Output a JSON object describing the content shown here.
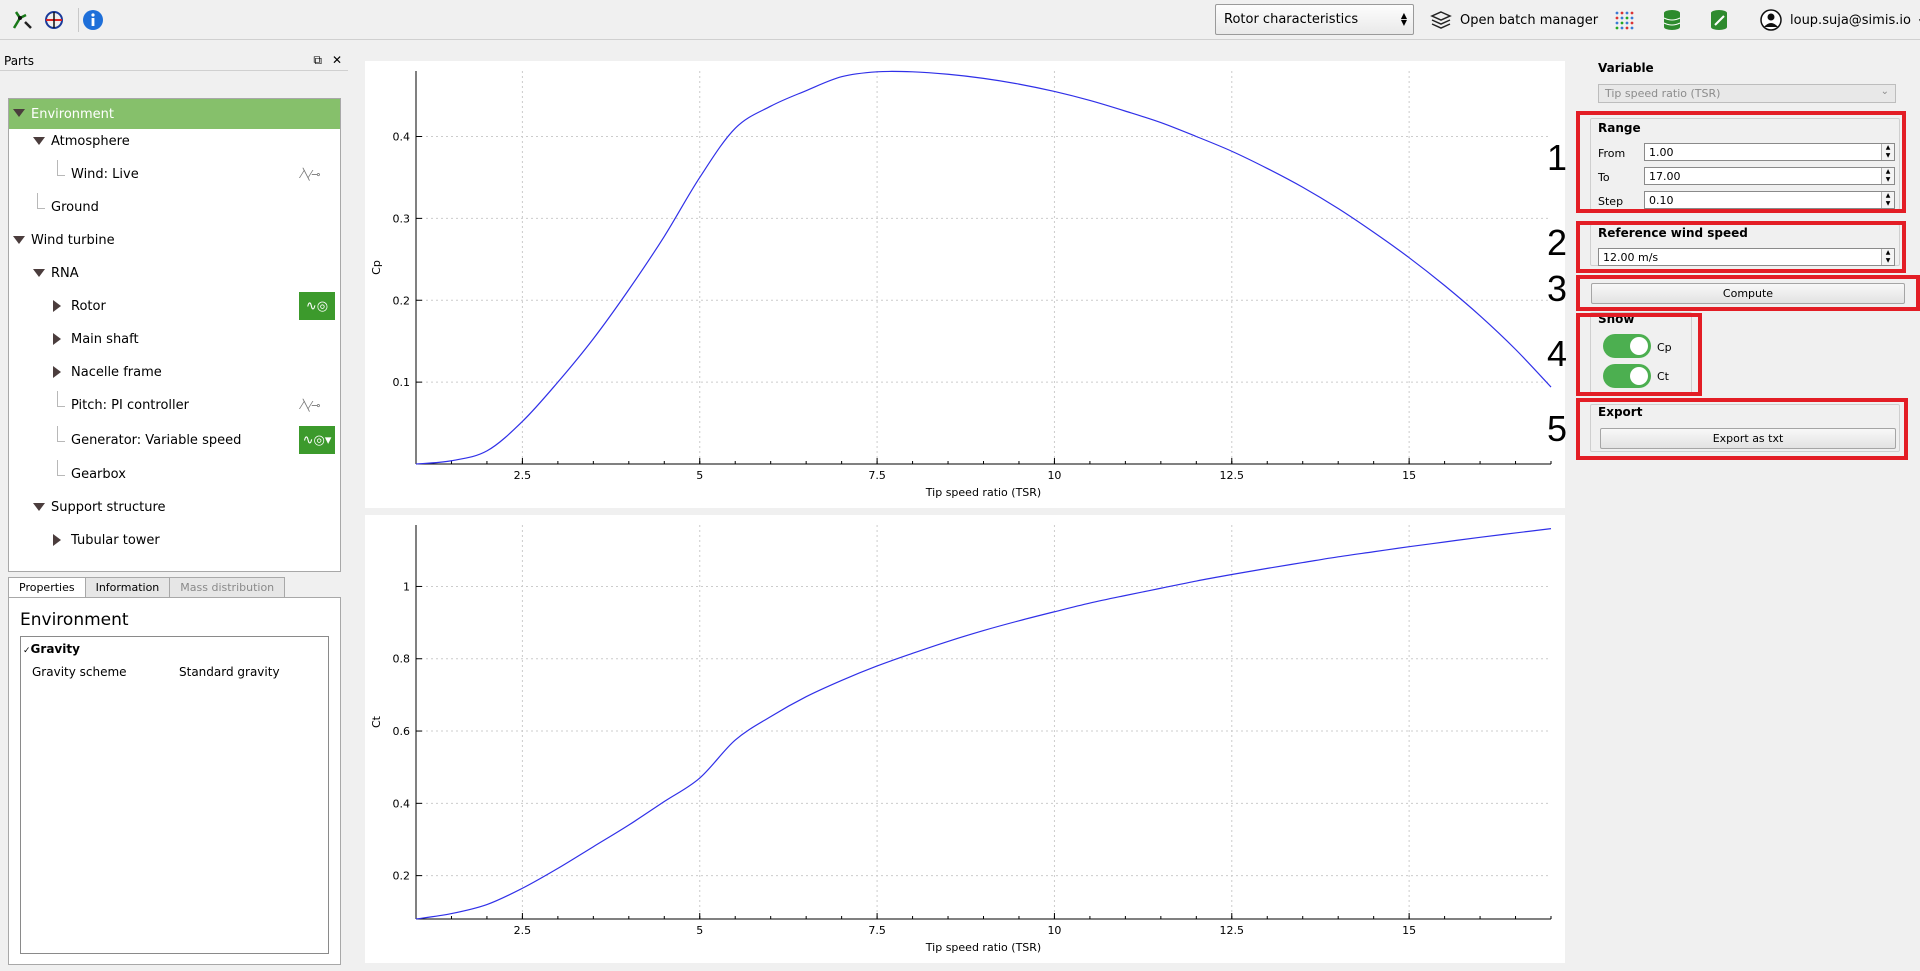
{
  "toolbar": {
    "icons": [
      "turbine-wrench-icon",
      "turbine-edit-icon",
      "info-icon"
    ],
    "mode_select": "Rotor characteristics",
    "batch_label": "Open batch manager",
    "user": "loup.suja@simis.io"
  },
  "parts": {
    "title": "Parts",
    "tree": [
      {
        "label": "Environment",
        "depth": 0,
        "expanded": true,
        "selected": true
      },
      {
        "label": "Atmosphere",
        "depth": 1,
        "expanded": true
      },
      {
        "label": "Wind: Live",
        "depth": 2,
        "icon": "waveform-icon"
      },
      {
        "label": "Ground",
        "depth": 1
      },
      {
        "label": "Wind turbine",
        "depth": 0,
        "expanded": true
      },
      {
        "label": "RNA",
        "depth": 1,
        "expanded": true
      },
      {
        "label": "Rotor",
        "depth": 2,
        "collapsed": true,
        "badge": "green"
      },
      {
        "label": "Main shaft",
        "depth": 2,
        "collapsed": true
      },
      {
        "label": "Nacelle frame",
        "depth": 2,
        "collapsed": true
      },
      {
        "label": "Pitch: PI controller",
        "depth": 2,
        "icon": "waveform-icon"
      },
      {
        "label": "Generator: Variable speed",
        "depth": 2,
        "badge": "green-dropdown"
      },
      {
        "label": "Gearbox",
        "depth": 2
      },
      {
        "label": "Support structure",
        "depth": 1,
        "expanded": true
      },
      {
        "label": "Tubular tower",
        "depth": 2,
        "collapsed": true
      }
    ]
  },
  "properties": {
    "tabs": [
      "Properties",
      "Information",
      "Mass distribution"
    ],
    "heading": "Environment",
    "group": "Gravity",
    "rows": [
      {
        "name": "Gravity scheme",
        "value": "Standard gravity"
      }
    ]
  },
  "chart_data": [
    {
      "type": "line",
      "xlabel": "Tip speed ratio (TSR)",
      "ylabel": "Cp",
      "xlim": [
        1,
        17
      ],
      "ylim": [
        0,
        0.48
      ],
      "xticks": [
        "2.5",
        "5",
        "7.5",
        "10",
        "12.5",
        "15"
      ],
      "yticks": [
        "0.1",
        "0.2",
        "0.3",
        "0.4"
      ],
      "grid": true,
      "color": "#3030e8",
      "x": [
        1,
        1.5,
        2,
        2.5,
        3,
        3.5,
        4,
        4.5,
        5,
        5.5,
        6,
        6.5,
        7,
        7.5,
        8,
        8.5,
        9,
        9.5,
        10,
        10.5,
        11,
        11.5,
        12,
        12.5,
        13,
        13.5,
        14,
        14.5,
        15,
        15.5,
        16,
        16.5,
        17
      ],
      "y": [
        0.0,
        0.004,
        0.016,
        0.052,
        0.1,
        0.153,
        0.213,
        0.278,
        0.35,
        0.41,
        0.437,
        0.456,
        0.473,
        0.479,
        0.479,
        0.476,
        0.471,
        0.464,
        0.455,
        0.444,
        0.431,
        0.417,
        0.4,
        0.382,
        0.361,
        0.338,
        0.312,
        0.283,
        0.252,
        0.218,
        0.181,
        0.14,
        0.094
      ]
    },
    {
      "type": "line",
      "xlabel": "Tip speed ratio (TSR)",
      "ylabel": "Ct",
      "xlim": [
        1,
        17
      ],
      "ylim": [
        0.08,
        1.17
      ],
      "xticks": [
        "2.5",
        "5",
        "7.5",
        "10",
        "12.5",
        "15"
      ],
      "yticks": [
        "0.2",
        "0.4",
        "0.6",
        "0.8",
        "1"
      ],
      "grid": true,
      "color": "#3030e8",
      "x": [
        1,
        1.5,
        2,
        2.5,
        3,
        3.5,
        4,
        4.5,
        5,
        5.5,
        6,
        6.5,
        7,
        7.5,
        8,
        8.5,
        9,
        9.5,
        10,
        10.5,
        11,
        11.5,
        12,
        12.5,
        13,
        13.5,
        14,
        14.5,
        15,
        15.5,
        16,
        16.5,
        17
      ],
      "y": [
        0.08,
        0.095,
        0.12,
        0.165,
        0.22,
        0.28,
        0.34,
        0.405,
        0.47,
        0.575,
        0.64,
        0.695,
        0.74,
        0.78,
        0.815,
        0.848,
        0.878,
        0.905,
        0.93,
        0.954,
        0.975,
        0.995,
        1.015,
        1.033,
        1.05,
        1.066,
        1.082,
        1.096,
        1.11,
        1.123,
        1.136,
        1.148,
        1.16
      ]
    }
  ],
  "side": {
    "variable_label": "Variable",
    "variable_value": "Tip speed ratio (TSR)",
    "range_label": "Range",
    "from_label": "From",
    "from_value": "1.00",
    "to_label": "To",
    "to_value": "17.00",
    "step_label": "Step",
    "step_value": "0.10",
    "ref_label": "Reference wind speed",
    "ref_value": "12.00 m/s",
    "compute_label": "Compute",
    "show_label": "Show",
    "toggle_cp": "Cp",
    "toggle_ct": "Ct",
    "export_label": "Export",
    "export_button": "Export as txt"
  },
  "annotations": [
    "1",
    "2",
    "3",
    "4",
    "5"
  ],
  "colors": {
    "selection": "#86c06b",
    "badge": "#3c9a2c",
    "toggle": "#4caf50",
    "annotation": "#e31d25"
  }
}
